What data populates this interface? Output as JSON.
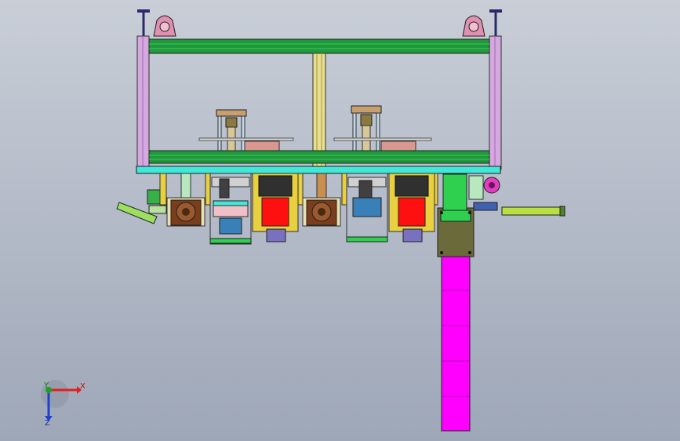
{
  "viewport": {
    "background_top": "#c9ced7",
    "background_bottom": "#9ea7b8"
  },
  "triad": {
    "x_label": "X",
    "y_label": "Y",
    "z_label": "Z",
    "x_color": "#e02020",
    "y_color": "#20a020",
    "z_color": "#2040d0"
  },
  "model": {
    "frame_color": "#1e9a3a",
    "post_color": "#d6a8e0",
    "table_color": "#40e8d8",
    "pusher_color": "#ff00ff",
    "motor_color": "#ff1010",
    "gearbox_color": "#7a3e1c",
    "cylinder_color": "#b8e040",
    "panel_color": "#6a6a3a"
  }
}
